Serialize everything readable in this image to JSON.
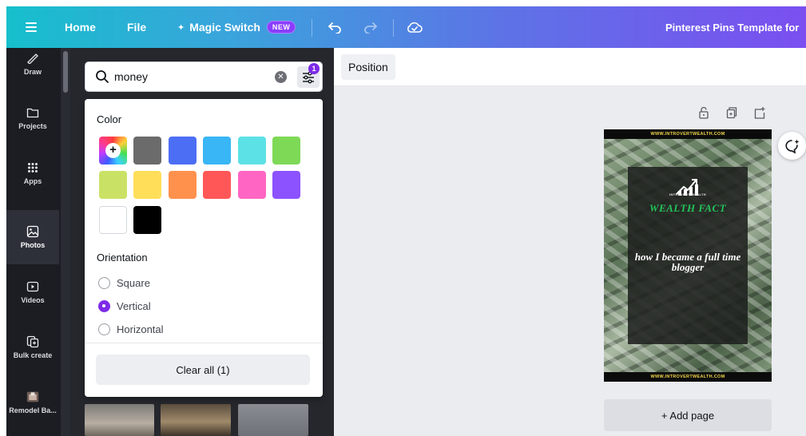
{
  "topbar": {
    "home_label": "Home",
    "file_label": "File",
    "magic_switch_label": "Magic Switch",
    "new_badge": "NEW",
    "doc_title": "Pinterest Pins Template for",
    "gradient_start": "#16bfcc",
    "gradient_end": "#7b4ff0"
  },
  "rail": {
    "items": [
      {
        "label": "Draw",
        "icon": "draw-icon"
      },
      {
        "label": "Projects",
        "icon": "folder-icon"
      },
      {
        "label": "Apps",
        "icon": "apps-grid-icon"
      },
      {
        "label": "Photos",
        "icon": "photo-icon",
        "active": true
      },
      {
        "label": "Videos",
        "icon": "video-icon"
      },
      {
        "label": "Bulk create",
        "icon": "bulk-create-icon"
      },
      {
        "label": "Remodel Ba...",
        "icon": "app-thumbnail-icon"
      }
    ]
  },
  "search": {
    "value": "money",
    "filter_count": "1"
  },
  "filters": {
    "color_heading": "Color",
    "colors": [
      "#6b6b6b",
      "#4c6ef5",
      "#38b6f5",
      "#5ce1e6",
      "#7ed957",
      "#c9e265",
      "#ffde59",
      "#ff914d",
      "#ff5757",
      "#ff66c4",
      "#8c52ff",
      "#ffffff",
      "#000000"
    ],
    "orientation_heading": "Orientation",
    "orientation_options": [
      {
        "label": "Square",
        "checked": false
      },
      {
        "label": "Vertical",
        "checked": true
      },
      {
        "label": "Horizontal",
        "checked": false
      }
    ],
    "clear_all_label": "Clear all (1)"
  },
  "context_bar": {
    "position_label": "Position"
  },
  "pin": {
    "url_top": "WWW.INTROVERTWEALTH.COM",
    "brand": "INTROVERT WEALTH",
    "heading": "WEALTH FACT",
    "subheading": "how I became a full time blogger",
    "url_bottom": "WWW.INTROVERTWEALTH.COM",
    "heading_color": "#23c35a"
  },
  "add_page_label": "+ Add page",
  "accent_color": "#7d2ae8"
}
